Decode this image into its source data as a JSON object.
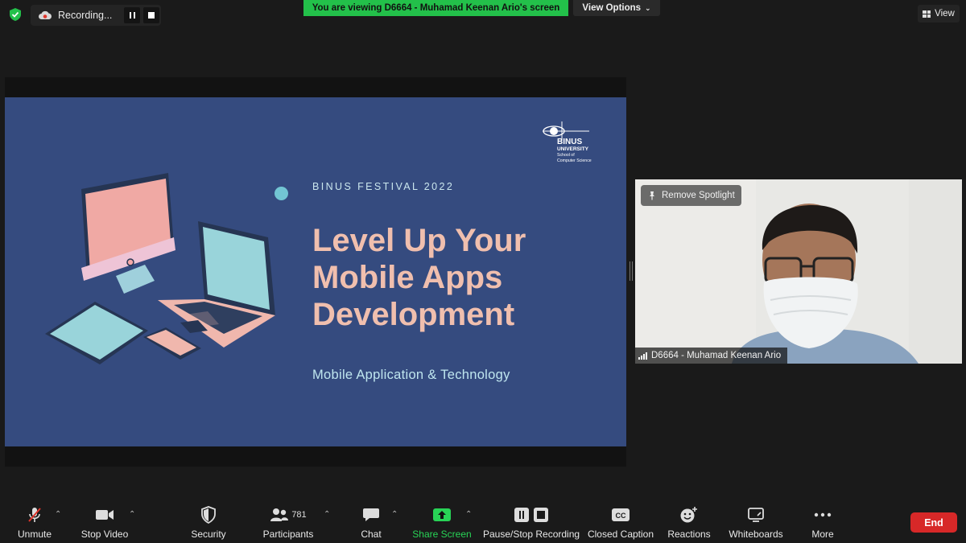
{
  "top_bar": {
    "recording_label": "Recording...",
    "viewing_banner": "You are viewing D6664 - Muhamad Keenan Ario's screen",
    "view_options_label": "View Options",
    "view_label": "View"
  },
  "slide": {
    "logo_text": "BINUS UNIVERSITY School of Computer Science",
    "kicker": "BINUS FESTIVAL 2022",
    "title": "Level Up Your Mobile Apps Development",
    "subtitle": "Mobile Application & Technology"
  },
  "video": {
    "remove_spotlight": "Remove Spotlight",
    "participant_name": "D6664 - Muhamad Keenan Ario"
  },
  "toolbar": {
    "unmute": "Unmute",
    "stop_video": "Stop Video",
    "security": "Security",
    "participants": "Participants",
    "participant_count": "781",
    "chat": "Chat",
    "share_screen": "Share Screen",
    "pause_stop_recording": "Pause/Stop Recording",
    "closed_caption": "Closed Caption",
    "reactions": "Reactions",
    "whiteboards": "Whiteboards",
    "more": "More",
    "end": "End"
  },
  "colors": {
    "app_bg": "#1a1a1a",
    "banner_green": "#23c04a",
    "share_green": "#28d356",
    "end_red": "#d72828",
    "slide_bg": "#354b7f",
    "slide_title": "#f0bfae",
    "slide_subtitle": "#bfe6ef"
  }
}
